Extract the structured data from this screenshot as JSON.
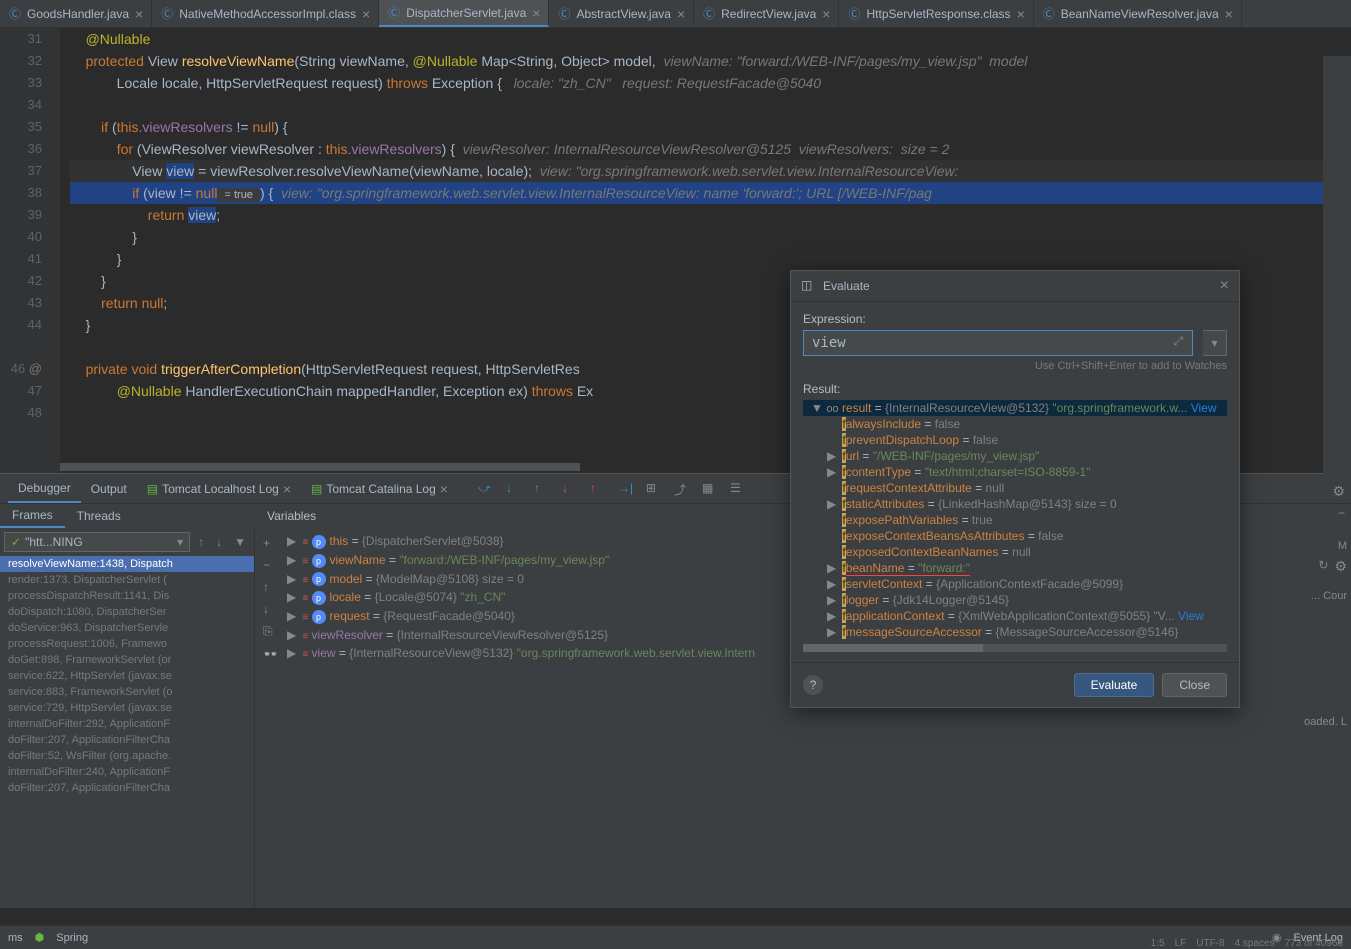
{
  "tabs": [
    {
      "name": "GoodsHandler.java",
      "icon": "java",
      "active": false
    },
    {
      "name": "NativeMethodAccessorImpl.class",
      "icon": "java",
      "active": false
    },
    {
      "name": "DispatcherServlet.java",
      "icon": "java",
      "active": true
    },
    {
      "name": "AbstractView.java",
      "icon": "java",
      "active": false
    },
    {
      "name": "RedirectView.java",
      "icon": "java",
      "active": false
    },
    {
      "name": "HttpServletResponse.class",
      "icon": "java",
      "active": false
    },
    {
      "name": "BeanNameViewResolver.java",
      "icon": "java",
      "active": false
    }
  ],
  "lineNumbers": [
    "31",
    "32",
    "33",
    "34",
    "35",
    "36",
    "37",
    "38",
    "39",
    "40",
    "41",
    "42",
    "43",
    "44",
    "",
    "46",
    "47",
    "48"
  ],
  "code": {
    "l31": "@Nullable",
    "l32_kw": "protected ",
    "l32_type": "View ",
    "l32_method": "resolveViewName",
    "l32_params": "(String viewName, ",
    "l32_ann": "@Nullable",
    "l32_params2": " Map<String, Object> model,",
    "l32_hint": "  viewName: \"forward:/WEB-INF/pages/my_view.jsp\"  model",
    "l33": "        Locale locale, HttpServletRequest request) ",
    "l33_throws": "throws ",
    "l33_exc": "Exception {",
    "l33_hint": "   locale: \"zh_CN\"   request: RequestFacade@5040",
    "l35_if": "if ",
    "l35_cond": "(",
    "l35_this": "this",
    "l35_field": ".viewResolvers",
    "l35_rest": " != ",
    "l35_null": "null",
    "l35_close": ") {",
    "l36_for": "for ",
    "l36_rest": "(ViewResolver viewResolver : ",
    "l36_this": "this",
    "l36_field": ".viewResolvers",
    "l36_close": ") {",
    "l36_hint": "  viewResolver: InternalResourceViewResolver@5125  viewResolvers:  size = 2",
    "l37": "View ",
    "l37_var": "view",
    "l37_rest": " = viewResolver.resolveViewName(viewName, locale);",
    "l37_hint": "  view: \"org.springframework.web.servlet.view.InternalResourceView:",
    "l38_if": "if ",
    "l38_open": "(view != ",
    "l38_null": "null",
    "l38_hint": " = true ",
    "l38_close": ") {",
    "l38_hint2": "  view: \"org.springframework.web.servlet.view.InternalResourceView: name 'forward:'; URL [/WEB-INF/pag",
    "l39_ret": "return ",
    "l39_var": "view",
    "l39_semi": ";",
    "l40": "}",
    "l41": "}",
    "l42": "}",
    "l43_ret": "return ",
    "l43_null": "null",
    "l43_semi": ";",
    "l44": "}",
    "l46_kw": "private ",
    "l46_void": "void ",
    "l46_method": "triggerAfterCompletion",
    "l46_params": "(HttpServletRequest request, HttpServletRes",
    "l47_ann": "@Nullable",
    "l47_rest": " HandlerExecutionChain mappedHandler, Exception ex) ",
    "l47_throws": "throws ",
    "l47_exc": "Ex"
  },
  "debugTabs": {
    "debugger": "Debugger",
    "output": "Output",
    "tomcatLocal": "Tomcat Localhost Log",
    "tomcatCatalina": "Tomcat Catalina Log"
  },
  "subTabs": {
    "frames": "Frames",
    "threads": "Threads",
    "variables": "Variables"
  },
  "threadSelector": "\"htt...NING",
  "frames": [
    {
      "text": "resolveViewName:1438, Dispatch",
      "selected": true
    },
    {
      "text": "render:1373, DispatcherServlet (",
      "selected": false
    },
    {
      "text": "processDispatchResult:1141, Dis",
      "selected": false
    },
    {
      "text": "doDispatch:1080, DispatcherSer",
      "selected": false
    },
    {
      "text": "doService:963, DispatcherServle",
      "selected": false
    },
    {
      "text": "processRequest:1006, Framewo",
      "selected": false
    },
    {
      "text": "doGet:898, FrameworkServlet (or",
      "selected": false
    },
    {
      "text": "service:622, HttpServlet (javax.se",
      "selected": false
    },
    {
      "text": "service:883, FrameworkServlet (o",
      "selected": false
    },
    {
      "text": "service:729, HttpServlet (javax.se",
      "selected": false
    },
    {
      "text": "internalDoFilter:292, ApplicationF",
      "selected": false
    },
    {
      "text": "doFilter:207, ApplicationFilterCha",
      "selected": false
    },
    {
      "text": "doFilter:52, WsFilter (org.apache.",
      "selected": false
    },
    {
      "text": "internalDoFilter:240, ApplicationF",
      "selected": false
    },
    {
      "text": "doFilter:207, ApplicationFilterCha",
      "selected": false
    }
  ],
  "variables": [
    {
      "icon": "p",
      "name": "this",
      "val": "{DispatcherServlet@5038}"
    },
    {
      "icon": "p",
      "name": "viewName",
      "str": "\"forward:/WEB-INF/pages/my_view.jsp\""
    },
    {
      "icon": "p",
      "name": "model",
      "val": "{ModelMap@5108}  size = 0"
    },
    {
      "icon": "p",
      "name": "locale",
      "val": "{Locale@5074} ",
      "str": "\"zh_CN\""
    },
    {
      "icon": "p",
      "name": "request",
      "val": "{RequestFacade@5040}"
    },
    {
      "icon": "",
      "name": "viewResolver",
      "val": "{InternalResourceViewResolver@5125}"
    },
    {
      "icon": "",
      "name": "view",
      "val": "{InternalResourceView@5132} ",
      "str": "\"org.springframework.web.servlet.view.Intern"
    }
  ],
  "evaluate": {
    "title": "Evaluate",
    "expressionLabel": "Expression:",
    "expression": "view",
    "hint": "Use Ctrl+Shift+Enter to add to Watches",
    "resultLabel": "Result:",
    "evaluateBtn": "Evaluate",
    "closeBtn": "Close",
    "tree": [
      {
        "indent": 0,
        "arrow": "▼",
        "icon": "oo",
        "name": "result",
        "val": "{InternalResourceView@5132} ",
        "str": "\"org.springframework.w...",
        "link": "View",
        "root": true
      },
      {
        "indent": 1,
        "arrow": "",
        "icon": "f",
        "name": "alwaysInclude",
        "val": "false"
      },
      {
        "indent": 1,
        "arrow": "",
        "icon": "f",
        "name": "preventDispatchLoop",
        "val": "false"
      },
      {
        "indent": 1,
        "arrow": "▶",
        "icon": "f",
        "name": "url",
        "str": "\"/WEB-INF/pages/my_view.jsp\""
      },
      {
        "indent": 1,
        "arrow": "▶",
        "icon": "f",
        "name": "contentType",
        "str": "\"text/html;charset=ISO-8859-1\""
      },
      {
        "indent": 1,
        "arrow": "",
        "icon": "f",
        "name": "requestContextAttribute",
        "val": "null"
      },
      {
        "indent": 1,
        "arrow": "▶",
        "icon": "f",
        "name": "staticAttributes",
        "val": "{LinkedHashMap@5143}  size = 0"
      },
      {
        "indent": 1,
        "arrow": "",
        "icon": "f",
        "name": "exposePathVariables",
        "val": "true"
      },
      {
        "indent": 1,
        "arrow": "",
        "icon": "f",
        "name": "exposeContextBeansAsAttributes",
        "val": "false"
      },
      {
        "indent": 1,
        "arrow": "",
        "icon": "f",
        "name": "exposedContextBeanNames",
        "val": "null"
      },
      {
        "indent": 1,
        "arrow": "▶",
        "icon": "f",
        "name": "beanName",
        "str": "\"forward:\"",
        "underline": true
      },
      {
        "indent": 1,
        "arrow": "▶",
        "icon": "f",
        "name": "servletContext",
        "val": "{ApplicationContextFacade@5099}"
      },
      {
        "indent": 1,
        "arrow": "▶",
        "icon": "f",
        "name": "logger",
        "val": "{Jdk14Logger@5145}"
      },
      {
        "indent": 1,
        "arrow": "▶",
        "icon": "f",
        "name": "applicationContext",
        "val": "{XmlWebApplicationContext@5055} \"V...",
        "link": "View"
      },
      {
        "indent": 1,
        "arrow": "▶",
        "icon": "f",
        "name": "messageSourceAccessor",
        "val": "{MessageSourceAccessor@5146}"
      }
    ]
  },
  "statusBar": {
    "left1": "ms",
    "left2": "Spring",
    "eventLog": "Event Log",
    "pos": "1:5",
    "lf": "LF",
    "enc": "UTF-8",
    "spaces": "4 spaces",
    "lines": "773 of 40968"
  },
  "sidePanel": {
    "cour": "... Cour",
    "m": "M",
    "loaded": "oaded. L"
  }
}
